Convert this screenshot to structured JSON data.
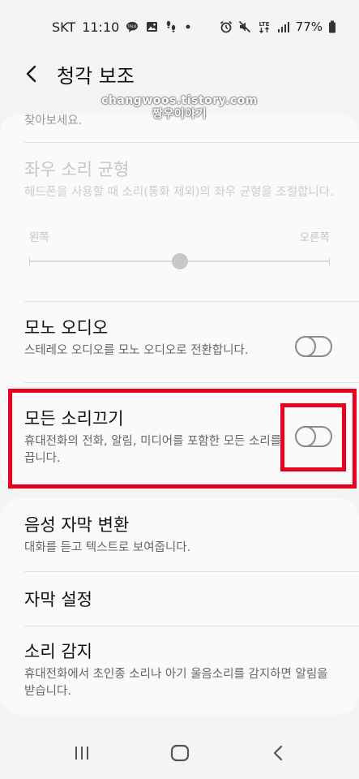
{
  "status_bar": {
    "carrier": "SKT",
    "time": "11:10",
    "battery": "77%",
    "network": "LTE",
    "icons_left": [
      "talk-icon",
      "image-icon",
      "footsteps-icon",
      "dot-icon"
    ],
    "icons_right": [
      "alarm-icon",
      "mute-icon",
      "lte-icon",
      "signal-icon",
      "battery-icon"
    ]
  },
  "header": {
    "title": "청각 보조"
  },
  "watermark": {
    "line1": "changwoos.tistory.com",
    "line2": "짱우이야기"
  },
  "settings": {
    "partial_text": "찾아보세요.",
    "balance": {
      "title": "좌우 소리 균형",
      "description": "헤드폰을 사용할 때 소리(통화 제외)의 좌우 균형을 조절합니다.",
      "left_label": "왼쪽",
      "right_label": "오른쪽",
      "value": 0.5,
      "enabled": false
    },
    "mono_audio": {
      "title": "모노 오디오",
      "description": "스테레오 오디오를 모노 오디오로 전환합니다.",
      "on": false
    },
    "mute_all": {
      "title": "모든 소리끄기",
      "description": "휴대전화의 전화, 알림, 미디어를 포함한 모든 소리를 끕니다.",
      "on": false
    },
    "live_caption": {
      "title": "음성 자막 변환",
      "description": "대화를 듣고 텍스트로 보여줍니다."
    },
    "caption_settings": {
      "title": "자막 설정"
    },
    "sound_detect": {
      "title": "소리 감지",
      "description": "휴대전화에서 초인종 소리나 아기 울음소리를 감지하면 알림을 받습니다."
    }
  },
  "highlight_color": "#e8001c",
  "nav": {
    "recents": "recents-icon",
    "home": "home-icon",
    "back": "back-icon"
  }
}
